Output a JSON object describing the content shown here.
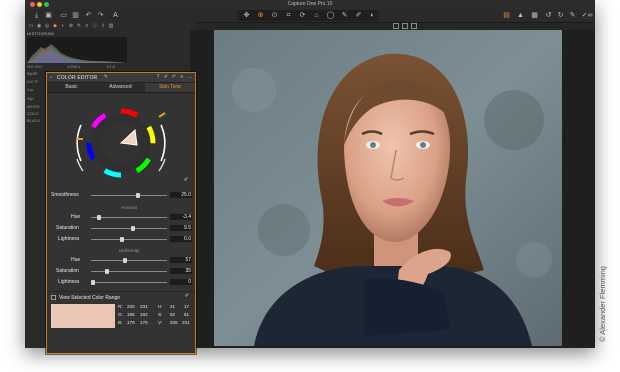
{
  "window": {
    "title": "Capture One Pro 10"
  },
  "sidebar": {
    "histogram_title": "HISTOGRAM",
    "histogram_info": {
      "iso": "ISO 200",
      "shutter": "1/250 s",
      "aperture": "f/1.8"
    },
    "sections": [
      "BASE",
      "ICC P",
      "Cur",
      "Styl",
      "WHITE",
      "COLO",
      "BLACK"
    ]
  },
  "color_editor": {
    "title": "COLOR EDITOR",
    "tabs": [
      {
        "label": "Basic"
      },
      {
        "label": "Advanced"
      },
      {
        "label": "Skin Tone"
      }
    ],
    "active_tab": "Skin Tone",
    "smoothness": {
      "label": "Smoothness",
      "value": "25.0",
      "level": 0.62
    },
    "amount": {
      "group_label": "Amount",
      "hue": {
        "label": "Hue",
        "value": "-3.4",
        "level": 0.08
      },
      "saturation": {
        "label": "Saturation",
        "value": "9.5",
        "level": 0.55
      },
      "lightness": {
        "label": "Lightness",
        "value": "0.0",
        "level": 0.4
      }
    },
    "uniformity": {
      "group_label": "Uniformity",
      "hue": {
        "label": "Hue",
        "value": "57",
        "level": 0.45
      },
      "saturation": {
        "label": "Saturation",
        "value": "35",
        "level": 0.2
      },
      "lightness": {
        "label": "Lightness",
        "value": "0",
        "level": 0.0
      }
    },
    "view_selected_label": "View Selected Color Range",
    "swatch_colors": [
      "#e9c8b7",
      "#ecc5b4"
    ],
    "readout": {
      "r": {
        "label": "R:",
        "a": "225",
        "b": "231"
      },
      "g": {
        "label": "G:",
        "a": "195",
        "b": "192"
      },
      "b": {
        "label": "B:",
        "a": "179",
        "b": "176"
      },
      "h": {
        "label": "H:",
        "a": "21",
        "b": "17"
      },
      "s": {
        "label": "S:",
        "a": "52",
        "b": "61"
      },
      "v": {
        "label": "V:",
        "a": "225",
        "b": "231"
      }
    }
  },
  "accent_color": "#f0952a",
  "photo_credit": "© Alexander Flemming"
}
